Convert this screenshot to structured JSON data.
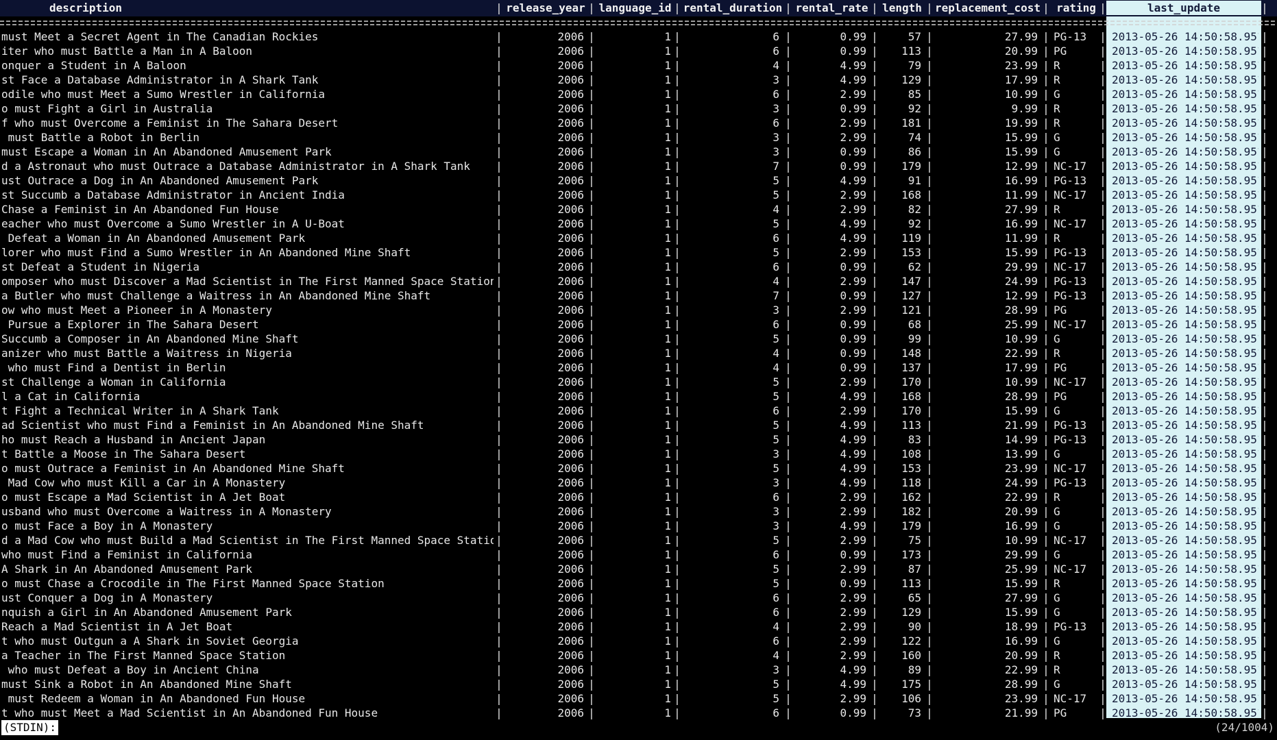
{
  "columns": {
    "description": "description",
    "release_year": "release_year",
    "language_id": "language_id",
    "rental_duration": "rental_duration",
    "rental_rate": "rental_rate",
    "length": "length",
    "replacement_cost": "replacement_cost",
    "rating": "rating",
    "last_update": "last_update"
  },
  "rows": [
    [
      "must Meet a Secret Agent in The Canadian Rockies",
      "2006",
      "1",
      "6",
      "0.99",
      "57",
      "27.99",
      "PG-13",
      "2013-05-26 14:50:58.951"
    ],
    [
      "iter who must Battle a Man in A Baloon",
      "2006",
      "1",
      "6",
      "0.99",
      "113",
      "20.99",
      "PG",
      "2013-05-26 14:50:58.951"
    ],
    [
      "onquer a Student in A Baloon",
      "2006",
      "1",
      "4",
      "4.99",
      "79",
      "23.99",
      "R",
      "2013-05-26 14:50:58.951"
    ],
    [
      "st Face a Database Administrator in A Shark Tank",
      "2006",
      "1",
      "3",
      "4.99",
      "129",
      "17.99",
      "R",
      "2013-05-26 14:50:58.951"
    ],
    [
      "odile who must Meet a Sumo Wrestler in California",
      "2006",
      "1",
      "6",
      "2.99",
      "85",
      "10.99",
      "G",
      "2013-05-26 14:50:58.951"
    ],
    [
      "o must Fight a Girl in Australia",
      "2006",
      "1",
      "3",
      "0.99",
      "92",
      "9.99",
      "R",
      "2013-05-26 14:50:58.951"
    ],
    [
      "f who must Overcome a Feminist in The Sahara Desert",
      "2006",
      "1",
      "6",
      "2.99",
      "181",
      "19.99",
      "R",
      "2013-05-26 14:50:58.951"
    ],
    [
      " must Battle a Robot in Berlin",
      "2006",
      "1",
      "3",
      "2.99",
      "74",
      "15.99",
      "G",
      "2013-05-26 14:50:58.951"
    ],
    [
      "must Escape a Woman in An Abandoned Amusement Park",
      "2006",
      "1",
      "3",
      "0.99",
      "86",
      "15.99",
      "G",
      "2013-05-26 14:50:58.951"
    ],
    [
      "d a Astronaut who must Outrace a Database Administrator in A Shark Tank",
      "2006",
      "1",
      "7",
      "0.99",
      "179",
      "12.99",
      "NC-17",
      "2013-05-26 14:50:58.951"
    ],
    [
      "ust Outrace a Dog in An Abandoned Amusement Park",
      "2006",
      "1",
      "5",
      "4.99",
      "91",
      "16.99",
      "PG-13",
      "2013-05-26 14:50:58.951"
    ],
    [
      "st Succumb a Database Administrator in Ancient India",
      "2006",
      "1",
      "5",
      "2.99",
      "168",
      "11.99",
      "NC-17",
      "2013-05-26 14:50:58.951"
    ],
    [
      "Chase a Feminist in An Abandoned Fun House",
      "2006",
      "1",
      "4",
      "2.99",
      "82",
      "27.99",
      "R",
      "2013-05-26 14:50:58.951"
    ],
    [
      "eacher who must Overcome a Sumo Wrestler in A U-Boat",
      "2006",
      "1",
      "5",
      "4.99",
      "92",
      "16.99",
      "NC-17",
      "2013-05-26 14:50:58.951"
    ],
    [
      " Defeat a Woman in An Abandoned Amusement Park",
      "2006",
      "1",
      "6",
      "4.99",
      "119",
      "11.99",
      "R",
      "2013-05-26 14:50:58.951"
    ],
    [
      "lorer who must Find a Sumo Wrestler in An Abandoned Mine Shaft",
      "2006",
      "1",
      "5",
      "2.99",
      "153",
      "15.99",
      "PG-13",
      "2013-05-26 14:50:58.951"
    ],
    [
      "st Defeat a Student in Nigeria",
      "2006",
      "1",
      "6",
      "0.99",
      "62",
      "29.99",
      "NC-17",
      "2013-05-26 14:50:58.951"
    ],
    [
      "omposer who must Discover a Mad Scientist in The First Manned Space Station",
      "2006",
      "1",
      "4",
      "2.99",
      "147",
      "24.99",
      "PG-13",
      "2013-05-26 14:50:58.951"
    ],
    [
      "a Butler who must Challenge a Waitress in An Abandoned Mine Shaft",
      "2006",
      "1",
      "7",
      "0.99",
      "127",
      "12.99",
      "PG-13",
      "2013-05-26 14:50:58.951"
    ],
    [
      "ow who must Meet a Pioneer in A Monastery",
      "2006",
      "1",
      "3",
      "2.99",
      "121",
      "28.99",
      "PG",
      "2013-05-26 14:50:58.951"
    ],
    [
      " Pursue a Explorer in The Sahara Desert",
      "2006",
      "1",
      "6",
      "0.99",
      "68",
      "25.99",
      "NC-17",
      "2013-05-26 14:50:58.951"
    ],
    [
      "Succumb a Composer in An Abandoned Mine Shaft",
      "2006",
      "1",
      "5",
      "0.99",
      "99",
      "10.99",
      "G",
      "2013-05-26 14:50:58.951"
    ],
    [
      "anizer who must Battle a Waitress in Nigeria",
      "2006",
      "1",
      "4",
      "0.99",
      "148",
      "22.99",
      "R",
      "2013-05-26 14:50:58.951"
    ],
    [
      " who must Find a Dentist in Berlin",
      "2006",
      "1",
      "4",
      "0.99",
      "137",
      "17.99",
      "PG",
      "2013-05-26 14:50:58.951"
    ],
    [
      "st Challenge a Woman in California",
      "2006",
      "1",
      "5",
      "2.99",
      "170",
      "10.99",
      "NC-17",
      "2013-05-26 14:50:58.951"
    ],
    [
      "l a Cat in California",
      "2006",
      "1",
      "5",
      "4.99",
      "168",
      "28.99",
      "PG",
      "2013-05-26 14:50:58.951"
    ],
    [
      "t Fight a Technical Writer in A Shark Tank",
      "2006",
      "1",
      "6",
      "2.99",
      "170",
      "15.99",
      "G",
      "2013-05-26 14:50:58.951"
    ],
    [
      "ad Scientist who must Find a Feminist in An Abandoned Mine Shaft",
      "2006",
      "1",
      "5",
      "4.99",
      "113",
      "21.99",
      "PG-13",
      "2013-05-26 14:50:58.951"
    ],
    [
      "ho must Reach a Husband in Ancient Japan",
      "2006",
      "1",
      "5",
      "4.99",
      "83",
      "14.99",
      "PG-13",
      "2013-05-26 14:50:58.951"
    ],
    [
      "t Battle a Moose in The Sahara Desert",
      "2006",
      "1",
      "3",
      "4.99",
      "108",
      "13.99",
      "G",
      "2013-05-26 14:50:58.951"
    ],
    [
      "o must Outrace a Feminist in An Abandoned Mine Shaft",
      "2006",
      "1",
      "5",
      "4.99",
      "153",
      "23.99",
      "NC-17",
      "2013-05-26 14:50:58.951"
    ],
    [
      " Mad Cow who must Kill a Car in A Monastery",
      "2006",
      "1",
      "3",
      "4.99",
      "118",
      "24.99",
      "PG-13",
      "2013-05-26 14:50:58.951"
    ],
    [
      "o must Escape a Mad Scientist in A Jet Boat",
      "2006",
      "1",
      "6",
      "2.99",
      "162",
      "22.99",
      "R",
      "2013-05-26 14:50:58.951"
    ],
    [
      "usband who must Overcome a Waitress in A Monastery",
      "2006",
      "1",
      "3",
      "2.99",
      "182",
      "20.99",
      "G",
      "2013-05-26 14:50:58.951"
    ],
    [
      "o must Face a Boy in A Monastery",
      "2006",
      "1",
      "3",
      "4.99",
      "179",
      "16.99",
      "G",
      "2013-05-26 14:50:58.951"
    ],
    [
      "d a Mad Cow who must Build a Mad Scientist in The First Manned Space Station",
      "2006",
      "1",
      "5",
      "2.99",
      "75",
      "10.99",
      "NC-17",
      "2013-05-26 14:50:58.951"
    ],
    [
      "who must Find a Feminist in California",
      "2006",
      "1",
      "6",
      "0.99",
      "173",
      "29.99",
      "G",
      "2013-05-26 14:50:58.951"
    ],
    [
      "A Shark in An Abandoned Amusement Park",
      "2006",
      "1",
      "5",
      "2.99",
      "87",
      "25.99",
      "NC-17",
      "2013-05-26 14:50:58.951"
    ],
    [
      "o must Chase a Crocodile in The First Manned Space Station",
      "2006",
      "1",
      "5",
      "0.99",
      "113",
      "15.99",
      "R",
      "2013-05-26 14:50:58.951"
    ],
    [
      "ust Conquer a Dog in A Monastery",
      "2006",
      "1",
      "6",
      "2.99",
      "65",
      "27.99",
      "G",
      "2013-05-26 14:50:58.951"
    ],
    [
      "nquish a Girl in An Abandoned Amusement Park",
      "2006",
      "1",
      "6",
      "2.99",
      "129",
      "15.99",
      "G",
      "2013-05-26 14:50:58.951"
    ],
    [
      "Reach a Mad Scientist in A Jet Boat",
      "2006",
      "1",
      "4",
      "2.99",
      "90",
      "18.99",
      "PG-13",
      "2013-05-26 14:50:58.951"
    ],
    [
      "t who must Outgun a A Shark in Soviet Georgia",
      "2006",
      "1",
      "6",
      "2.99",
      "122",
      "16.99",
      "G",
      "2013-05-26 14:50:58.951"
    ],
    [
      "a Teacher in The First Manned Space Station",
      "2006",
      "1",
      "4",
      "2.99",
      "160",
      "20.99",
      "R",
      "2013-05-26 14:50:58.951"
    ],
    [
      " who must Defeat a Boy in Ancient China",
      "2006",
      "1",
      "3",
      "4.99",
      "89",
      "22.99",
      "R",
      "2013-05-26 14:50:58.951"
    ],
    [
      "must Sink a Robot in An Abandoned Mine Shaft",
      "2006",
      "1",
      "5",
      "4.99",
      "175",
      "28.99",
      "G",
      "2013-05-26 14:50:58.951"
    ],
    [
      " must Redeem a Woman in An Abandoned Fun House",
      "2006",
      "1",
      "5",
      "2.99",
      "106",
      "23.99",
      "NC-17",
      "2013-05-26 14:50:58.951"
    ],
    [
      "t who must Meet a Mad Scientist in An Abandoned Fun House",
      "2006",
      "1",
      "6",
      "0.99",
      "73",
      "21.99",
      "PG",
      "2013-05-26 14:50:58.951"
    ]
  ],
  "status": {
    "prompt": "(STDIN):",
    "position": "(24/1004)"
  },
  "colors": {
    "background": "#000000",
    "header_band": "#0c1230",
    "highlight": "#d9f2f5",
    "highlight_text": "#141c3a"
  }
}
